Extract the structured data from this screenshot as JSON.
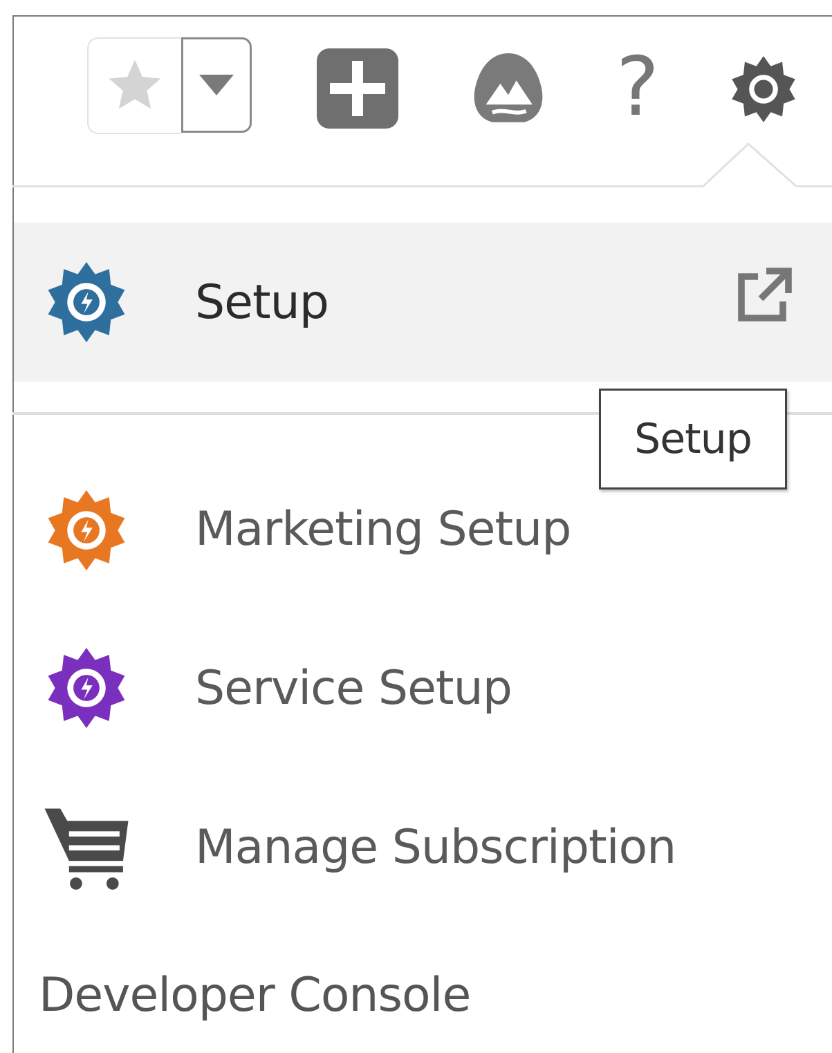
{
  "toolbar": {
    "favorites_icon": "star-icon",
    "favorites_dropdown_icon": "chevron-down-icon",
    "global_actions_icon": "plus-icon",
    "guidance_icon": "trailhead-icon",
    "help_icon": "help-icon",
    "help_glyph": "?",
    "setup_icon": "gear-icon"
  },
  "menu": {
    "items": [
      {
        "label": "Setup",
        "icon": "setup-gear-icon",
        "icon_color": "#2e6f9e",
        "active": true,
        "external_icon": "new-window-icon"
      },
      {
        "label": "Marketing Setup",
        "icon": "marketing-setup-gear-icon",
        "icon_color": "#e87722"
      },
      {
        "label": "Service Setup",
        "icon": "service-setup-gear-icon",
        "icon_color": "#7b2fbe"
      },
      {
        "label": "Manage Subscription",
        "icon": "cart-icon",
        "icon_color": "#4a4a4a"
      }
    ],
    "developer_console": "Developer Console"
  },
  "tooltip": {
    "text": "Setup"
  },
  "colors": {
    "active_bg": "#f2f2f2",
    "toolbar_icon": "#6f6f6f"
  }
}
